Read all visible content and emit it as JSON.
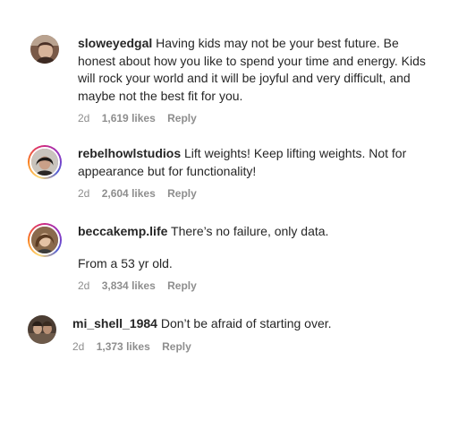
{
  "comments": [
    {
      "username": "sloweyedgal",
      "text": "Having kids may not be your best future. Be honest about how you like to spend your time and energy. Kids will rock your world and it will be joyful and very difficult, and maybe not the best fit for you.",
      "extra": "",
      "time": "2d",
      "likes": "1,619 likes",
      "reply": "Reply",
      "avatar_icon": "user-avatar-icon",
      "story_ring": false
    },
    {
      "username": "rebelhowlstudios",
      "text": "Lift weights! Keep lifting weights. Not for appearance but for functionality!",
      "extra": "",
      "time": "2d",
      "likes": "2,604 likes",
      "reply": "Reply",
      "avatar_icon": "user-avatar-icon",
      "story_ring": true
    },
    {
      "username": "beccakemp.life",
      "text": "There’s no failure, only data.",
      "extra": "From a 53 yr old.",
      "time": "2d",
      "likes": "3,834 likes",
      "reply": "Reply",
      "avatar_icon": "user-avatar-icon",
      "story_ring": true
    },
    {
      "username": "mi_shell_1984",
      "text": "Don’t be afraid of starting over.",
      "extra": "",
      "time": "2d",
      "likes": "1,373 likes",
      "reply": "Reply",
      "avatar_icon": "user-avatar-icon",
      "story_ring": false
    }
  ],
  "colors": {
    "text": "#262626",
    "meta": "#8e8e8e",
    "background": "#ffffff",
    "story_ring_gradient": [
      "#feda75",
      "#fa7e1e",
      "#d62976",
      "#962fbf",
      "#4f5bd5"
    ]
  }
}
